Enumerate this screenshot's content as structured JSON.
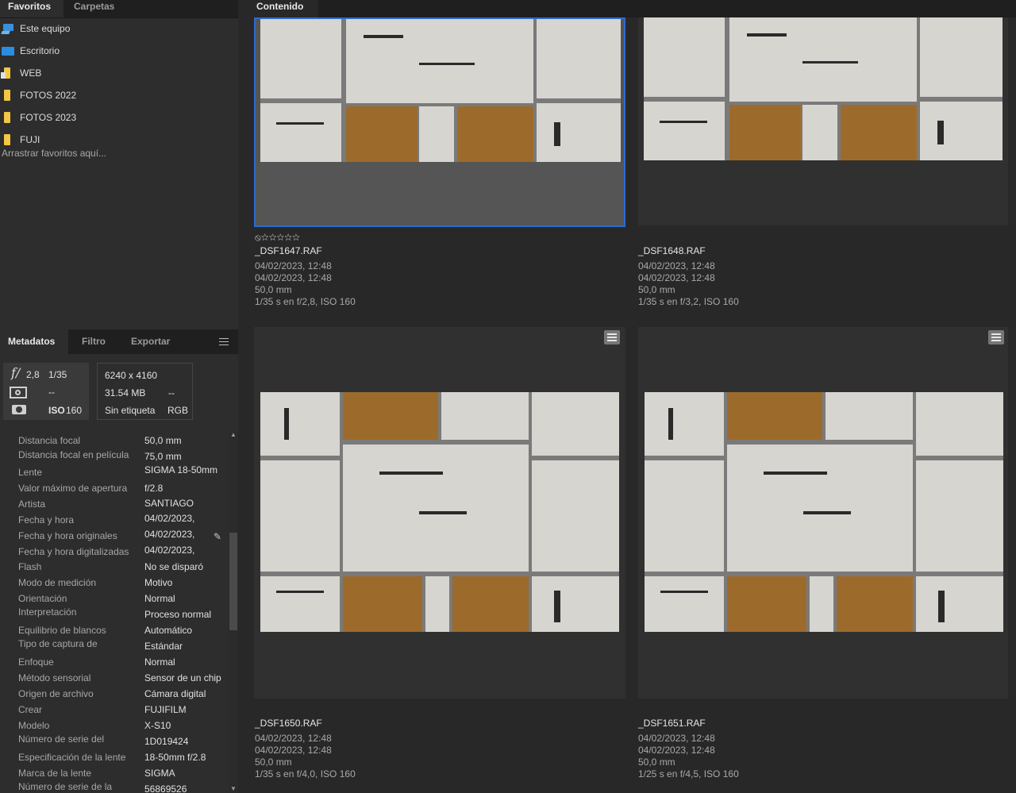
{
  "favorites_panel": {
    "tabs": [
      "Favoritos",
      "Carpetas"
    ],
    "items": [
      {
        "label": "Este equipo",
        "icon": "computer-icon"
      },
      {
        "label": "Escritorio",
        "icon": "desktop-icon"
      },
      {
        "label": "WEB",
        "icon": "folder-icon"
      },
      {
        "label": "FOTOS 2022",
        "icon": "folder-icon"
      },
      {
        "label": "FOTOS 2023",
        "icon": "folder-icon"
      },
      {
        "label": "FUJI",
        "icon": "folder-icon"
      }
    ],
    "hint": "Arrastrar favoritos aquí..."
  },
  "metadata_panel": {
    "tabs": [
      "Metadatos",
      "Filtro",
      "Exportar"
    ],
    "summary": {
      "aperture": "2,8",
      "shutter": "1/35",
      "metering": "--",
      "iso_label": "ISO",
      "iso": "160",
      "dimensions": "6240 x 4160",
      "size": "31.54 MB",
      "size_extra": "--",
      "label": "Sin etiqueta",
      "color_mode": "RGB"
    },
    "rows": [
      {
        "key": "Distancia focal",
        "value": "50,0 mm"
      },
      {
        "key": "Distancia focal en película",
        "value": "75,0 mm"
      },
      {
        "key": "Lente",
        "value": "SIGMA 18-50mm"
      },
      {
        "key": "Valor máximo de apertura",
        "value": "f/2.8"
      },
      {
        "key": "Artista",
        "value": "SANTIAGO"
      },
      {
        "key": "Fecha y hora",
        "value": "04/02/2023,"
      },
      {
        "key": "Fecha y hora originales",
        "value": "04/02/2023,"
      },
      {
        "key": "Fecha y hora digitalizadas",
        "value": "04/02/2023,"
      },
      {
        "key": "Flash",
        "value": "No se disparó"
      },
      {
        "key": "Modo de medición",
        "value": "Motivo"
      },
      {
        "key": "Orientación",
        "value": "Normal"
      },
      {
        "key": "Interpretación",
        "value": "Proceso normal"
      },
      {
        "key": "Equilibrio de blancos",
        "value": "Automático"
      },
      {
        "key": "Tipo de captura de",
        "value": "Estándar"
      },
      {
        "key": "Enfoque",
        "value": "Normal"
      },
      {
        "key": "Método sensorial",
        "value": "Sensor de un chip"
      },
      {
        "key": "Origen de archivo",
        "value": "Cámara digital"
      },
      {
        "key": "Crear",
        "value": "FUJIFILM"
      },
      {
        "key": "Modelo",
        "value": "X-S10"
      },
      {
        "key": "Número de serie del",
        "value": "1D019424"
      },
      {
        "key": "Especificación de la lente",
        "value": "18-50mm f/2.8"
      },
      {
        "key": "Marca de la lente",
        "value": "SIGMA"
      },
      {
        "key": "Número de serie de la",
        "value": "56869526"
      }
    ]
  },
  "content_panel": {
    "tab": "Contenido",
    "rating": "⦸☆☆☆☆☆",
    "items": [
      {
        "name": "_DSF1647.RAF",
        "created": "04/02/2023, 12:48",
        "modified": "04/02/2023, 12:48",
        "focal": "50,0 mm",
        "exposure": "1/35 s en f/2,8, ISO 160",
        "selected": true
      },
      {
        "name": "_DSF1648.RAF",
        "created": "04/02/2023, 12:48",
        "modified": "04/02/2023, 12:48",
        "focal": "50,0 mm",
        "exposure": "1/35 s en f/3,2, ISO 160",
        "selected": false
      },
      {
        "name": "_DSF1650.RAF",
        "created": "04/02/2023, 12:48",
        "modified": "04/02/2023, 12:48",
        "focal": "50,0 mm",
        "exposure": "1/35 s en f/4,0, ISO 160",
        "selected": false
      },
      {
        "name": "_DSF1651.RAF",
        "created": "04/02/2023, 12:48",
        "modified": "04/02/2023, 12:48",
        "focal": "50,0 mm",
        "exposure": "1/25 s en f/4,5, ISO 160",
        "selected": false
      }
    ]
  }
}
